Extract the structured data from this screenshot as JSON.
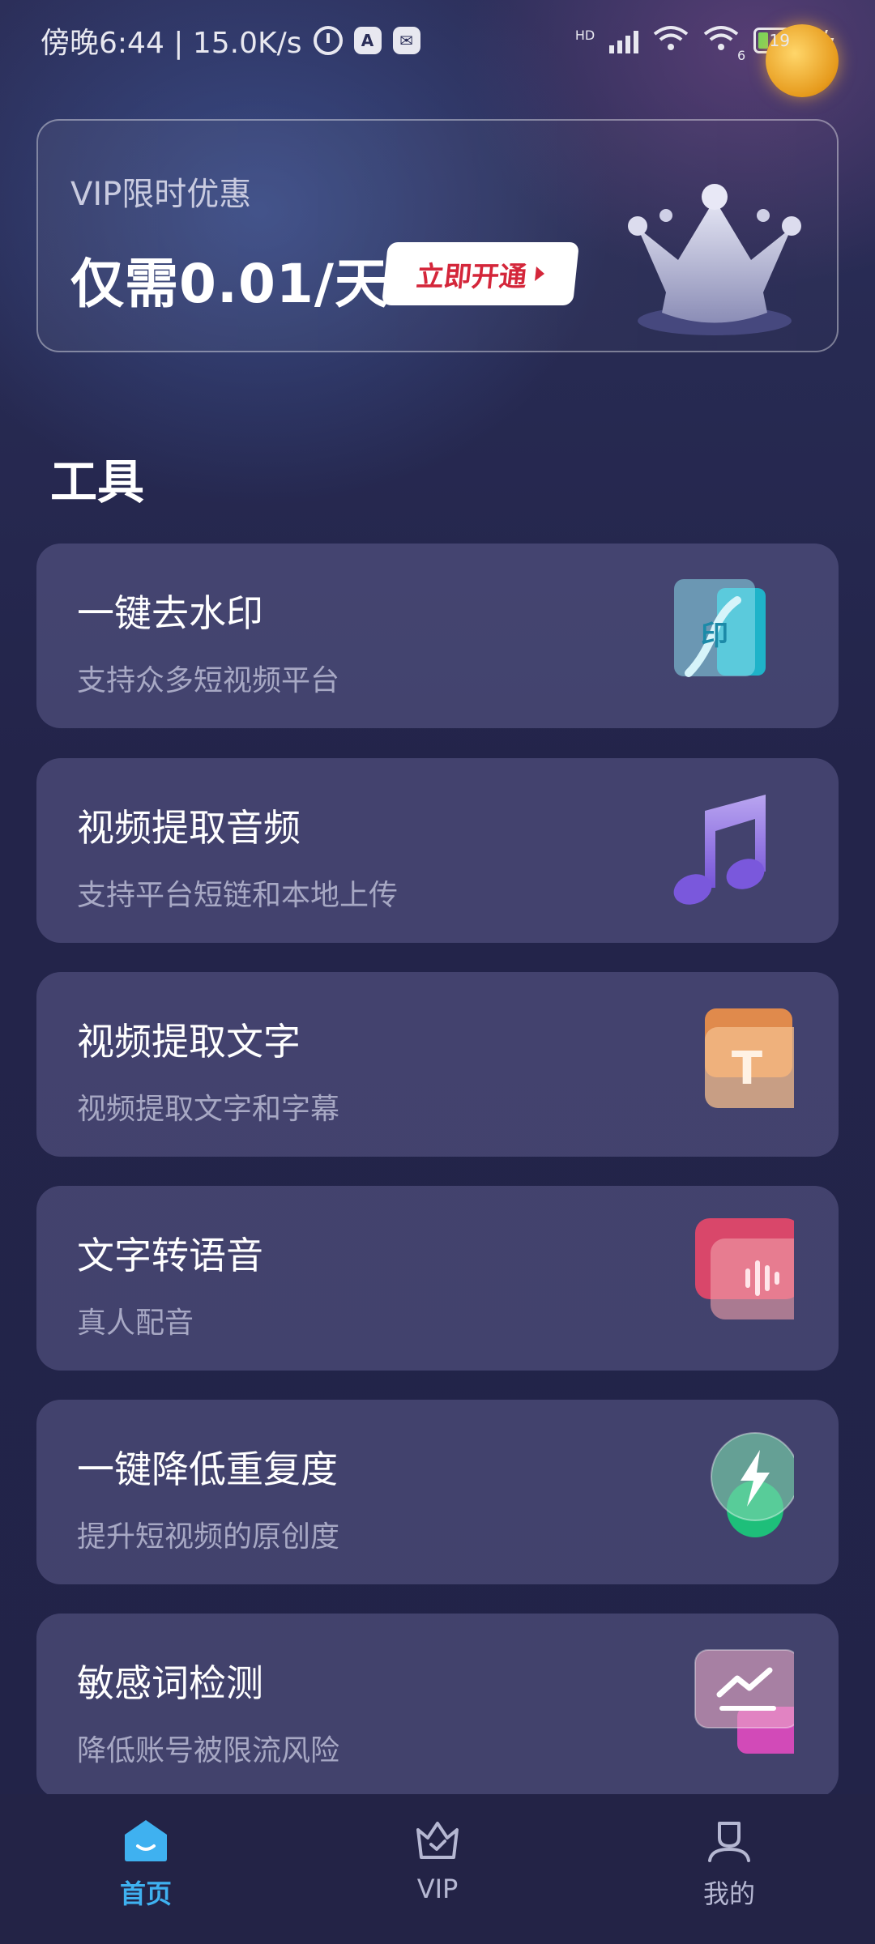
{
  "status_bar": {
    "time": "傍晚6:44 | 15.0K/s",
    "network_label": "HD",
    "wifi_sub": "6",
    "battery": "19"
  },
  "vip_banner": {
    "subtitle": "VIP限时优惠",
    "price": "仅需0.01/天",
    "button_label": "立即开通"
  },
  "tools": {
    "section_title": "工具",
    "items": [
      {
        "title": "一键去水印",
        "desc": "支持众多短视频平台",
        "icon": "watermark-icon",
        "icon_text": "印"
      },
      {
        "title": "视频提取音频",
        "desc": "支持平台短链和本地上传",
        "icon": "music-note-icon"
      },
      {
        "title": "视频提取文字",
        "desc": "视频提取文字和字幕",
        "icon": "text-t-icon",
        "icon_text": "T"
      },
      {
        "title": "文字转语音",
        "desc": "真人配音",
        "icon": "voice-wave-icon"
      },
      {
        "title": "一键降低重复度",
        "desc": "提升短视频的原创度",
        "icon": "lightning-icon"
      },
      {
        "title": "敏感词检测",
        "desc": "降低账号被限流风险",
        "icon": "trend-chart-icon"
      }
    ]
  },
  "nav": {
    "home": "首页",
    "vip": "VIP",
    "mine": "我的",
    "active": "home"
  },
  "colors": {
    "accent_blue": "#3fb1f0",
    "vip_red": "#d4263a"
  }
}
